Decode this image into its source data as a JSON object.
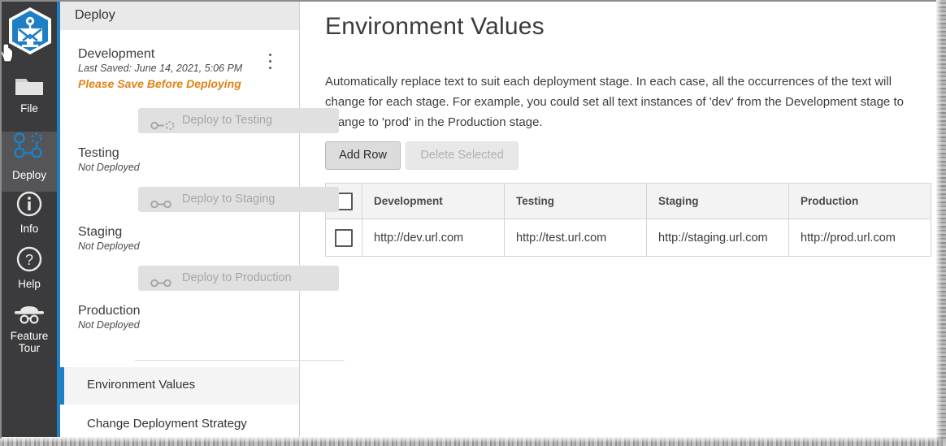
{
  "rail": {
    "logo_icon": "app-logo-icon",
    "items": [
      {
        "label": "File",
        "icon": "folder-icon",
        "name": "file"
      },
      {
        "label": "Deploy",
        "icon": "deploy-nodes-icon",
        "name": "deploy"
      },
      {
        "label": "Info",
        "icon": "info-circle-icon",
        "name": "info"
      },
      {
        "label": "Help",
        "icon": "question-circle-icon",
        "name": "help"
      },
      {
        "label": "Feature",
        "label2": "Tour",
        "icon": "explorer-hat-icon",
        "name": "feature-tour"
      }
    ]
  },
  "panel": {
    "header_title": "Deploy",
    "stages": [
      {
        "name": "Development",
        "sub": "Last Saved: June 14, 2021, 5:06 PM",
        "warning": "Please Save Before Deploying"
      },
      {
        "name": "Testing",
        "sub": "Not Deployed"
      },
      {
        "name": "Staging",
        "sub": "Not Deployed"
      },
      {
        "name": "Production",
        "sub": "Not Deployed"
      }
    ],
    "deploy_buttons": [
      {
        "label": "Deploy to Testing",
        "icon": "node-to-dotted-node-icon"
      },
      {
        "label": "Deploy to Staging",
        "icon": "node-to-node-icon"
      },
      {
        "label": "Deploy to Production",
        "icon": "node-to-node-icon"
      }
    ],
    "links": [
      {
        "label": "Environment Values",
        "selected": true
      },
      {
        "label": "Change Deployment Strategy",
        "selected": false
      }
    ]
  },
  "main": {
    "title": "Environment Values",
    "description": "Automatically replace text to suit each deployment stage. In each case, all the occurrences of the text will change for each stage. For example, you could set all text instances of 'dev' from the Development stage to change to 'prod' in the Production stage.",
    "add_row_label": "Add Row",
    "delete_selected_label": "Delete Selected",
    "table": {
      "columns": [
        "Development",
        "Testing",
        "Staging",
        "Production"
      ],
      "rows": [
        [
          "http://dev.url.com",
          "http://test.url.com",
          "http://staging.url.com",
          "http://prod.url.com"
        ]
      ]
    }
  },
  "colors": {
    "accent_blue": "#1f7fc4",
    "rail_dark": "#3b3b3d",
    "rail_active": "#555558",
    "warning_orange": "#e08214",
    "panel_header_gray": "#e9e9e9"
  }
}
